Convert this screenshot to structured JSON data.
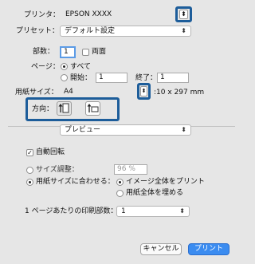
{
  "printer": {
    "label": "プリンタ：",
    "value": "EPSON XXXX"
  },
  "preset": {
    "label": "プリセット：",
    "value": "デフォルト設定"
  },
  "copies": {
    "label": "部数：",
    "value": "1",
    "duplex_label": "両面"
  },
  "pages": {
    "label": "ページ：",
    "all_label": "すべて",
    "from_label": "開始：",
    "from_value": "1",
    "to_label": "終了：",
    "to_value": "1"
  },
  "paper_size": {
    "label": "用紙サイズ：",
    "value": "A4",
    "dimensions": "10 x 297 mm"
  },
  "orientation": {
    "label": "方向："
  },
  "section_popup": {
    "value": "プレビュー"
  },
  "auto_rotate": {
    "label": "自動回転"
  },
  "scale": {
    "label": "サイズ調整：",
    "value": "96 %"
  },
  "fit": {
    "label": "用紙サイズに合わせる：",
    "option_entire": "イメージ全体をプリント",
    "option_fill": "用紙全体を埋める"
  },
  "pages_per_sheet": {
    "label": "1 ページあたりの印刷部数：",
    "value": "1"
  },
  "buttons": {
    "cancel": "キャンセル",
    "print": "プリント"
  },
  "colors": {
    "highlight": "#1d5d9a",
    "primary_button": "#3b8cf0"
  },
  "arrows": {
    "updown": "⬍",
    "down": "▼"
  }
}
